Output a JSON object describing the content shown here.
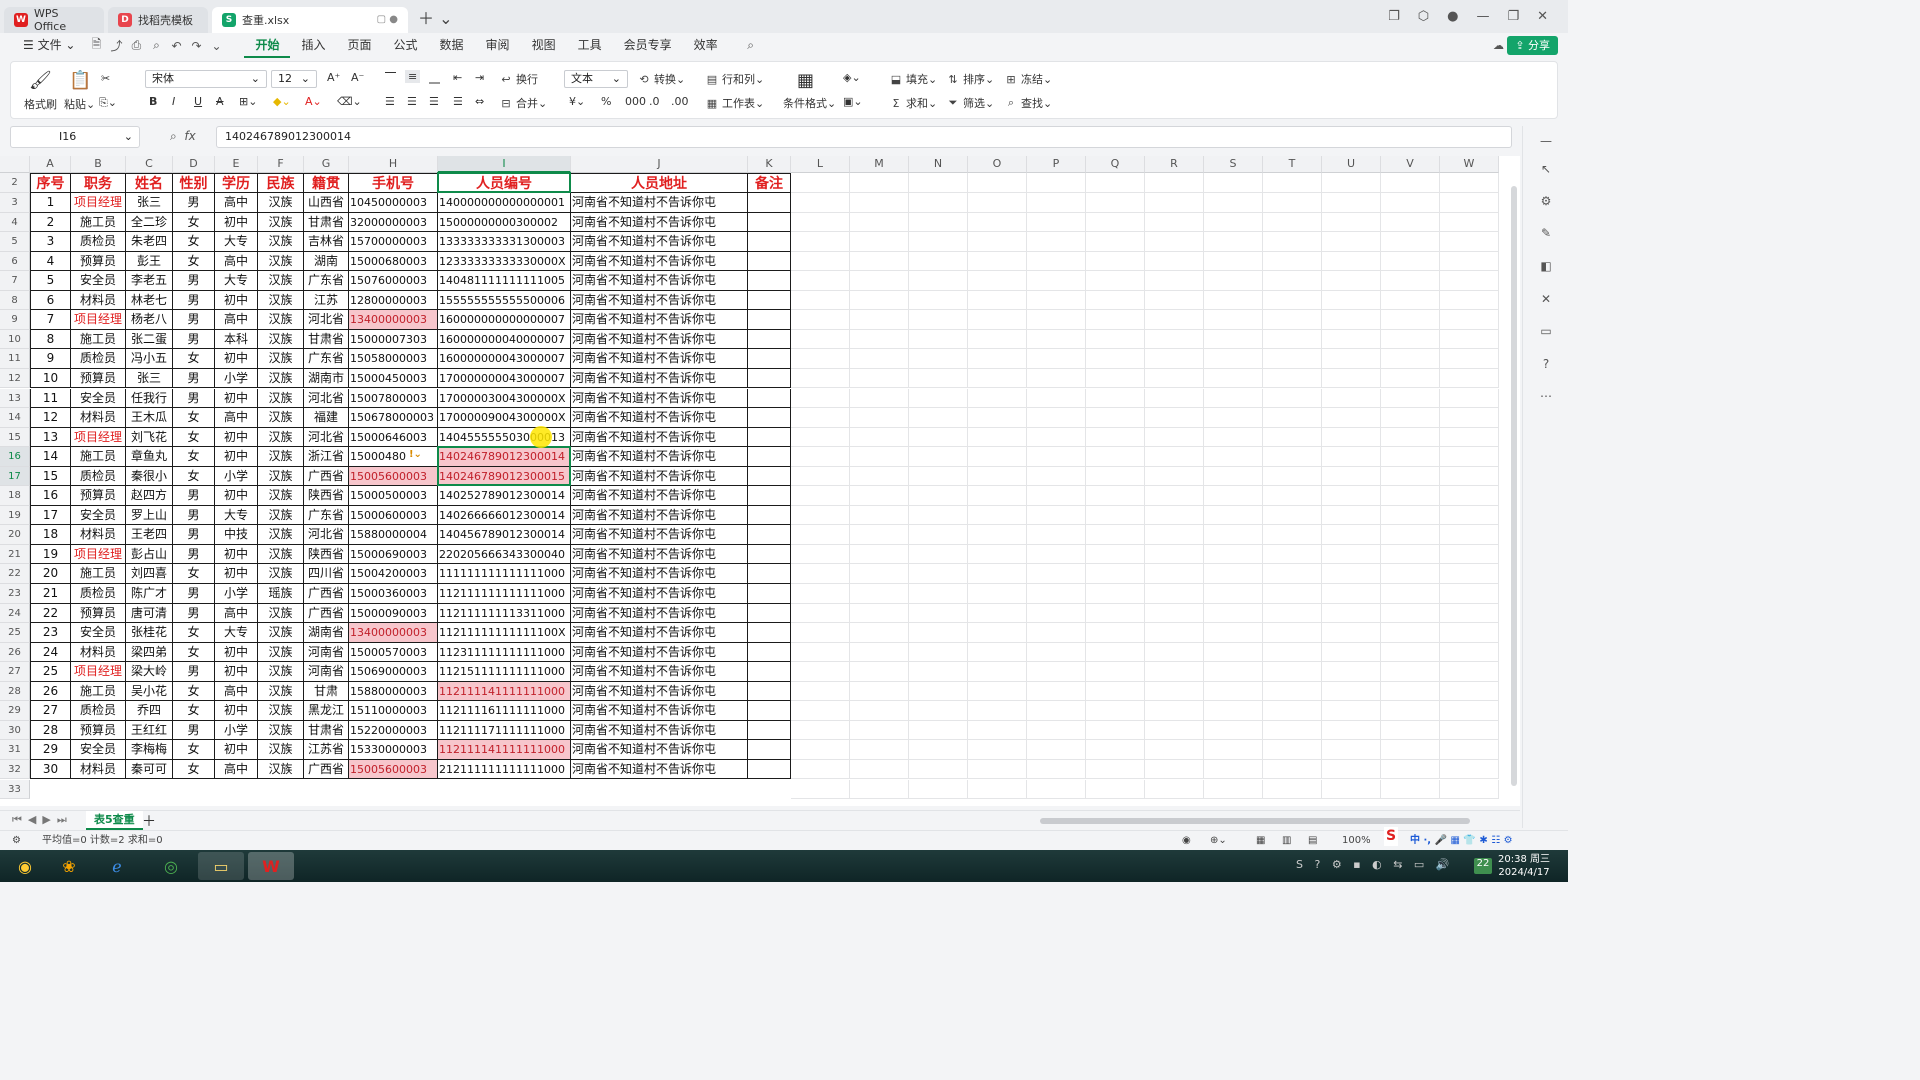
{
  "titlebar": {
    "tabs": [
      {
        "label": "WPS Office",
        "logo": "W",
        "color": "#e02020"
      },
      {
        "label": "找稻壳模板",
        "logo": "D",
        "color": "#e8454d"
      },
      {
        "label": "查重.xlsx",
        "logo": "S",
        "color": "#13a46a"
      }
    ]
  },
  "menu": {
    "file": "文件",
    "items": [
      "开始",
      "插入",
      "页面",
      "公式",
      "数据",
      "审阅",
      "视图",
      "工具",
      "会员专享",
      "效率"
    ],
    "active": "开始",
    "share": "分享"
  },
  "ribbon": {
    "format_painter": "格式刷",
    "paste": "粘贴",
    "font_name": "宋体",
    "font_size": "12",
    "wrap": "换行",
    "merge": "合并",
    "number_format": "文本",
    "convert": "转换",
    "rows_cols": "行和列",
    "worksheet": "工作表",
    "cond_format": "条件格式",
    "fill": "填充",
    "sort": "排序",
    "freeze": "冻结",
    "sum": "求和",
    "filter": "筛选",
    "find": "查找"
  },
  "formula_bar": {
    "cell_ref": "I16",
    "content": "140246789012300014"
  },
  "columns": [
    "A",
    "B",
    "C",
    "D",
    "E",
    "F",
    "G",
    "H",
    "I",
    "J",
    "K",
    "L",
    "M",
    "N",
    "O",
    "P",
    "Q",
    "R",
    "S",
    "T",
    "U",
    "V",
    "W"
  ],
  "table": {
    "headers": [
      "序号",
      "职务",
      "姓名",
      "性别",
      "学历",
      "民族",
      "籍贯",
      "手机号",
      "人员编号",
      "人员地址",
      "备注"
    ],
    "rows": [
      [
        "1",
        "项目经理",
        "张三",
        "男",
        "高中",
        "汉族",
        "山西省",
        "10450000003",
        "140000000000000001",
        "河南省不知道村不告诉你屯",
        ""
      ],
      [
        "2",
        "施工员",
        "全二珍",
        "女",
        "初中",
        "汉族",
        "甘肃省",
        "32000000003",
        "15000000000300002",
        "河南省不知道村不告诉你屯",
        ""
      ],
      [
        "3",
        "质检员",
        "朱老四",
        "女",
        "大专",
        "汉族",
        "吉林省",
        "15700000003",
        "133333333331300003",
        "河南省不知道村不告诉你屯",
        ""
      ],
      [
        "4",
        "预算员",
        "彭王",
        "女",
        "高中",
        "汉族",
        "湖南",
        "15000680003",
        "12333333333330000X",
        "河南省不知道村不告诉你屯",
        ""
      ],
      [
        "5",
        "安全员",
        "李老五",
        "男",
        "大专",
        "汉族",
        "广东省",
        "15076000003",
        "140481111111111005",
        "河南省不知道村不告诉你屯",
        ""
      ],
      [
        "6",
        "材料员",
        "林老七",
        "男",
        "初中",
        "汉族",
        "江苏",
        "12800000003",
        "155555555555500006",
        "河南省不知道村不告诉你屯",
        ""
      ],
      [
        "7",
        "项目经理",
        "杨老八",
        "男",
        "高中",
        "汉族",
        "河北省",
        "13400000003",
        "160000000000000007",
        "河南省不知道村不告诉你屯",
        ""
      ],
      [
        "8",
        "施工员",
        "张二蛋",
        "男",
        "本科",
        "汉族",
        "甘肃省",
        "15000007303",
        "160000000040000007",
        "河南省不知道村不告诉你屯",
        ""
      ],
      [
        "9",
        "质检员",
        "冯小五",
        "女",
        "初中",
        "汉族",
        "广东省",
        "15058000003",
        "160000000043000007",
        "河南省不知道村不告诉你屯",
        ""
      ],
      [
        "10",
        "预算员",
        "张三",
        "男",
        "小学",
        "汉族",
        "湖南市",
        "15000450003",
        "170000000043000007",
        "河南省不知道村不告诉你屯",
        ""
      ],
      [
        "11",
        "安全员",
        "任我行",
        "男",
        "初中",
        "汉族",
        "河北省",
        "15007800003",
        "17000003004300000X",
        "河南省不知道村不告诉你屯",
        ""
      ],
      [
        "12",
        "材料员",
        "王木瓜",
        "女",
        "高中",
        "汉族",
        "福建",
        "150678000003",
        "17000009004300000X",
        "河南省不知道村不告诉你屯",
        ""
      ],
      [
        "13",
        "项目经理",
        "刘飞花",
        "女",
        "初中",
        "汉族",
        "河北省",
        "15000646003",
        "140455555503000013",
        "河南省不知道村不告诉你屯",
        ""
      ],
      [
        "14",
        "施工员",
        "章鱼丸",
        "女",
        "初中",
        "汉族",
        "浙江省",
        "15000480",
        "140246789012300014",
        "河南省不知道村不告诉你屯",
        ""
      ],
      [
        "15",
        "质检员",
        "秦很小",
        "女",
        "小学",
        "汉族",
        "广西省",
        "15005600003",
        "140246789012300015",
        "河南省不知道村不告诉你屯",
        ""
      ],
      [
        "16",
        "预算员",
        "赵四方",
        "男",
        "初中",
        "汉族",
        "陕西省",
        "15000500003",
        "140252789012300014",
        "河南省不知道村不告诉你屯",
        ""
      ],
      [
        "17",
        "安全员",
        "罗上山",
        "男",
        "大专",
        "汉族",
        "广东省",
        "15000600003",
        "140266666012300014",
        "河南省不知道村不告诉你屯",
        ""
      ],
      [
        "18",
        "材料员",
        "王老四",
        "男",
        "中技",
        "汉族",
        "河北省",
        "15880000004",
        "140456789012300014",
        "河南省不知道村不告诉你屯",
        ""
      ],
      [
        "19",
        "项目经理",
        "彭占山",
        "男",
        "初中",
        "汉族",
        "陕西省",
        "15000690003",
        "220205666343300040",
        "河南省不知道村不告诉你屯",
        ""
      ],
      [
        "20",
        "施工员",
        "刘四喜",
        "女",
        "初中",
        "汉族",
        "四川省",
        "15004200003",
        "111111111111111000",
        "河南省不知道村不告诉你屯",
        ""
      ],
      [
        "21",
        "质检员",
        "陈广才",
        "男",
        "小学",
        "瑶族",
        "广西省",
        "15000360003",
        "112111111111111000",
        "河南省不知道村不告诉你屯",
        ""
      ],
      [
        "22",
        "预算员",
        "唐可清",
        "男",
        "高中",
        "汉族",
        "广西省",
        "15000090003",
        "112111111113311000",
        "河南省不知道村不告诉你屯",
        ""
      ],
      [
        "23",
        "安全员",
        "张桂花",
        "女",
        "大专",
        "汉族",
        "湖南省",
        "13400000003",
        "11211111111111100X",
        "河南省不知道村不告诉你屯",
        ""
      ],
      [
        "24",
        "材料员",
        "梁四弟",
        "女",
        "初中",
        "汉族",
        "河南省",
        "15000570003",
        "112311111111111000",
        "河南省不知道村不告诉你屯",
        ""
      ],
      [
        "25",
        "项目经理",
        "梁大岭",
        "男",
        "初中",
        "汉族",
        "河南省",
        "15069000003",
        "112151111111111000",
        "河南省不知道村不告诉你屯",
        ""
      ],
      [
        "26",
        "施工员",
        "吴小花",
        "女",
        "高中",
        "汉族",
        "甘肃",
        "15880000003",
        "112111141111111000",
        "河南省不知道村不告诉你屯",
        ""
      ],
      [
        "27",
        "质检员",
        "乔四",
        "女",
        "初中",
        "汉族",
        "黑龙江",
        "15110000003",
        "112111161111111000",
        "河南省不知道村不告诉你屯",
        ""
      ],
      [
        "28",
        "预算员",
        "王红红",
        "男",
        "小学",
        "汉族",
        "甘肃省",
        "15220000003",
        "112111171111111000",
        "河南省不知道村不告诉你屯",
        ""
      ],
      [
        "29",
        "安全员",
        "李梅梅",
        "女",
        "初中",
        "汉族",
        "江苏省",
        "15330000003",
        "112111141111111000",
        "河南省不知道村不告诉你屯",
        ""
      ],
      [
        "30",
        "材料员",
        "秦可可",
        "女",
        "高中",
        "汉族",
        "广西省",
        "15005600003",
        "212111111111111000",
        "河南省不知道村不告诉你屯",
        ""
      ]
    ],
    "pink_phone_rows": [
      7,
      15,
      23,
      30
    ],
    "pink_id_rows": [
      14,
      15,
      26,
      29
    ]
  },
  "sheet_tab": "表5查重",
  "status": {
    "summary": "平均值=0  计数=2  求和=0",
    "zoom": "100%"
  },
  "clock": {
    "time": "20:38 周三",
    "date": "2024/4/17"
  },
  "colors": {
    "accent": "#0e8a4a",
    "header_red": "#e02020",
    "duplicate_fill": "#f7c6cc"
  }
}
